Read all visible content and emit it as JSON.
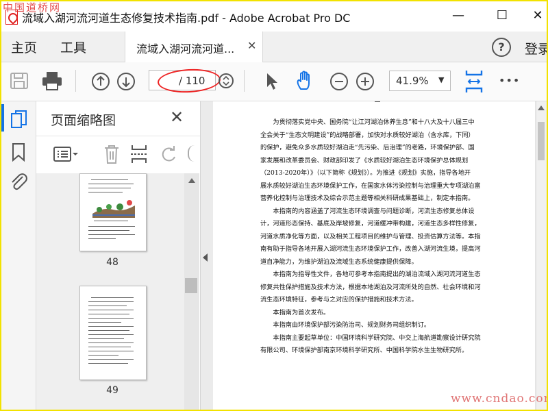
{
  "window": {
    "title": "流域入湖河流河道生态修复技术指南.pdf - Adobe Acrobat Pro DC",
    "minimize": "—",
    "maximize": "☐",
    "close": "✕"
  },
  "watermark_top": "中国道桥网",
  "menu": {
    "home": "主页",
    "tools": "工具",
    "login": "登录"
  },
  "tab": {
    "label": "流域入湖河流河道...",
    "close": "✕"
  },
  "toolbar": {
    "page_current": "",
    "page_total": "/ 110",
    "zoom": "41.9%",
    "more": "•••"
  },
  "panel": {
    "title": "页面缩略图",
    "close": "✕",
    "thumbnails": [
      {
        "page": "48"
      },
      {
        "page": "49"
      }
    ]
  },
  "document": {
    "lines": [
      "为贯彻落实党中央、国务院“让江河湖泊休养生息”和十八大及十八届三中",
      "全会关于“生态文明建设”的战略部署，加快对水质较好湖泊（含水库，下同）",
      "的保护，避免众多水质较好湖泊走“先污染、后治理”的老路，环境保护部、国",
      "家发展和改革委员会、财政部印发了《水质较好湖泊生态环境保护总体规划",
      "（2013-2020年）》（以下简称《规划》）。为推进《规划》实施，指导各地开",
      "展水质较好湖泊生态环境保护工作，在国家水体污染控制与治理重大专项湖泊富",
      "营养化控制与治理技术及综合示范主题等相关科研成果基础上，制定本指南。",
      "本指南的内容涵盖了河流生态环境调查与问题诊断，河流生态修复总体设",
      "计，河道形态保持、基底及岸坡修复，河道缓冲带构建，河道生态多样性修复，",
      "河道水质净化等方面，以及相关工程项目的维护与管理、投资估算方法等。本指",
      "南有助于指导各地开展入湖河流生态环境保护工作，改善入湖河流生境，提高河",
      "道自净能力，为维护湖泊及流域生态系统健康提供保障。",
      "本指南为指导性文件，各地可参考本指南提出的湖泊流域入湖河流河道生态",
      "修复共性保护措施及技术方法，根据本地湖泊及河流所处的自然、社会环境和河",
      "流生态环境特征，参考与之对应的保护措施和技术方法。",
      "本指南为首次发布。",
      "本指南由环境保护部污染防治司、规划财务司组织制订。",
      "本指南主要起草单位：中国环境科学研究院、中交上海航道勘察设计研究院",
      "有限公司、环境保护部南京环境科学研究所、中国科学院水生生物研究所。"
    ]
  },
  "watermark_bottom": "www.cndao.com",
  "colors": {
    "accent": "#1473e6",
    "annotation": "#e22222",
    "frame": "#f2e200"
  }
}
